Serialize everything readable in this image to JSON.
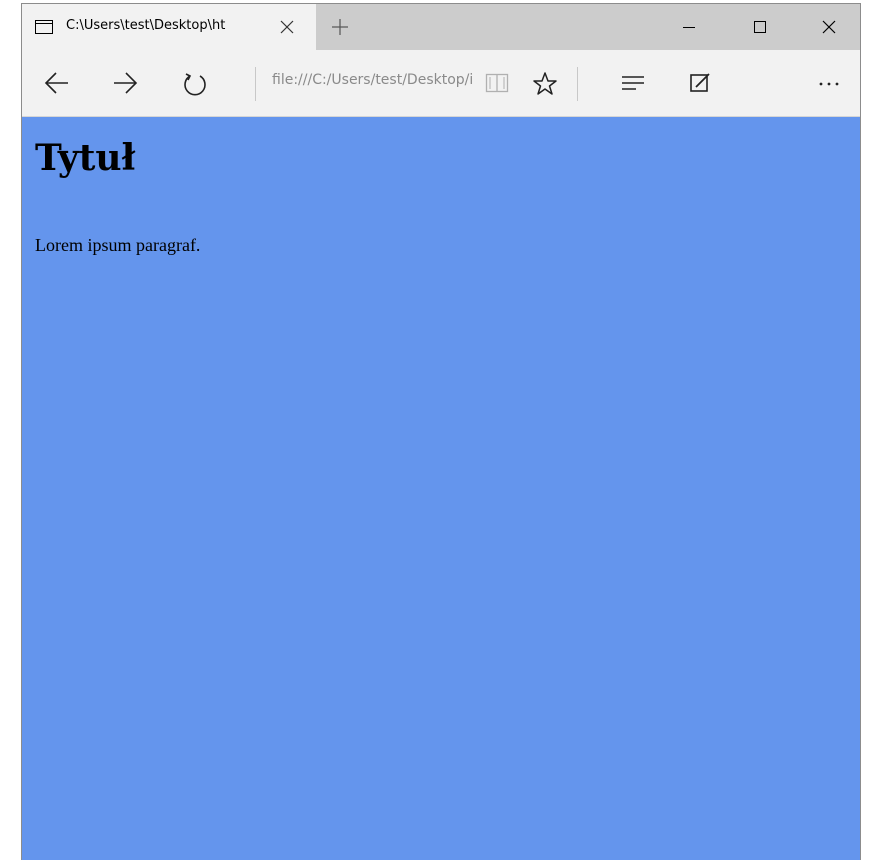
{
  "tab": {
    "title": "C:\\Users\\test\\Desktop\\ht",
    "icon": "tab-page-icon"
  },
  "toolbar": {
    "address": "file:///C:/Users/test/Desktop/index.html"
  },
  "page": {
    "heading": "Tytuł",
    "paragraph": "Lorem ipsum paragraf.",
    "background_color": "#6495ed"
  }
}
